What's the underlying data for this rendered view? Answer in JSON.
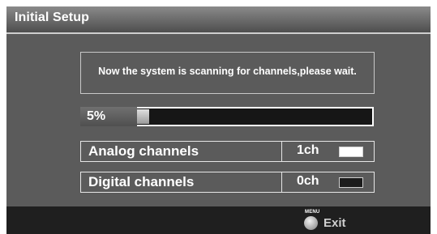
{
  "window": {
    "title": "Initial Setup"
  },
  "scan": {
    "message": "Now the system is scanning for channels,please wait.",
    "progress_label": "5%",
    "progress_fraction": 0.05
  },
  "channels": [
    {
      "label": "Analog channels",
      "count": "1ch",
      "indicator_state": "filled"
    },
    {
      "label": "Digital channels",
      "count": "0ch",
      "indicator_state": "empty"
    }
  ],
  "footer": {
    "button_caption": "MENU",
    "button_icon": "round-button-icon",
    "action_label": "Exit"
  },
  "colors": {
    "panel_bg": "#5b5b5b",
    "footer_bg": "#1f1f1f",
    "text": "#ffffff"
  }
}
